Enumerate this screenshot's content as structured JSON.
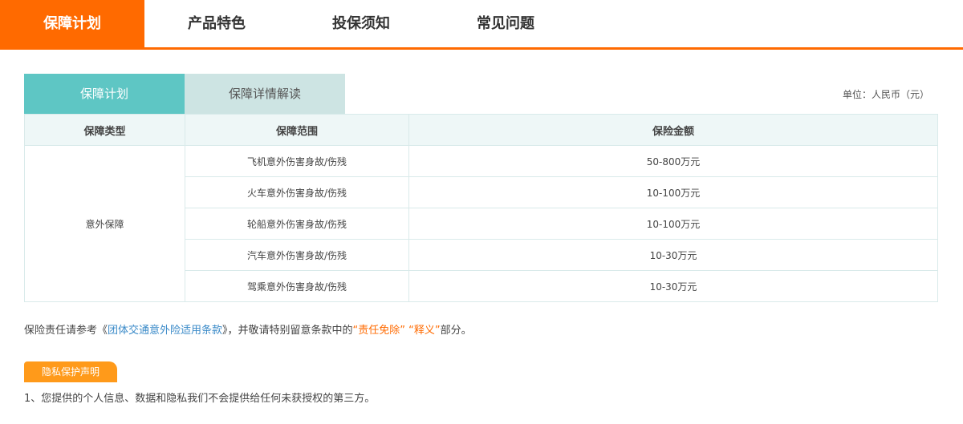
{
  "topnav": {
    "tabs": [
      {
        "label": "保障计划"
      },
      {
        "label": "产品特色"
      },
      {
        "label": "投保须知"
      },
      {
        "label": "常见问题"
      }
    ]
  },
  "subtabs": [
    {
      "label": "保障计划"
    },
    {
      "label": "保障详情解读"
    }
  ],
  "unit_label": "单位：人民币（元）",
  "table": {
    "headers": [
      "保障类型",
      "保障范围",
      "保险金额"
    ],
    "group_label": "意外保障",
    "rows": [
      {
        "scope": "飞机意外伤害身故/伤残",
        "amount": "50-800万元"
      },
      {
        "scope": "火车意外伤害身故/伤残",
        "amount": "10-100万元"
      },
      {
        "scope": "轮船意外伤害身故/伤残",
        "amount": "10-100万元"
      },
      {
        "scope": "汽车意外伤害身故/伤残",
        "amount": "10-30万元"
      },
      {
        "scope": "驾乘意外伤害身故/伤残",
        "amount": "10-30万元"
      }
    ]
  },
  "note": {
    "prefix": "保险责任请参考《",
    "link": "团体交通意外险适用条款",
    "middle": "》，并敬请特别留意条款中的",
    "highlight1": "“责任免除”",
    "highlight2": "“释义”",
    "suffix": "部分。"
  },
  "privacy": {
    "badge": "隐私保护声明",
    "text": "1、您提供的个人信息、数据和隐私我们不会提供给任何未获授权的第三方。"
  },
  "colors": {
    "accent": "#ff6a00",
    "teal": "#5ec6c4",
    "teal_light": "#cde4e3",
    "link": "#3a8ac8",
    "badge": "#ff9a1a"
  }
}
